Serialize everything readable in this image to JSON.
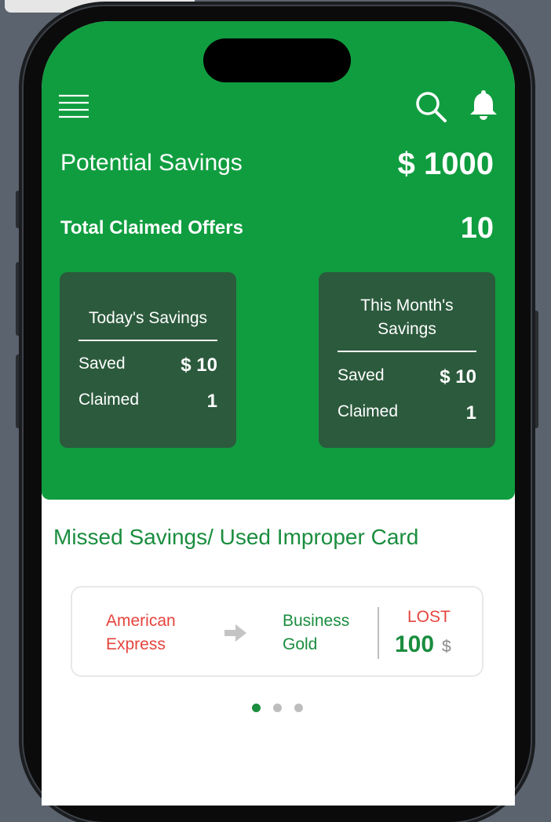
{
  "header": {
    "potential_savings_label": "Potential Savings",
    "potential_savings_value": "$ 1000",
    "total_claimed_label": "Total Claimed Offers",
    "total_claimed_value": "10"
  },
  "cards": {
    "today": {
      "title": "Today's Savings",
      "saved_label": "Saved",
      "saved_value": "$ 10",
      "claimed_label": "Claimed",
      "claimed_value": "1"
    },
    "month": {
      "title": "This Month's Savings",
      "saved_label": "Saved",
      "saved_value": "$ 10",
      "claimed_label": "Claimed",
      "claimed_value": "1"
    }
  },
  "missed": {
    "title": "Missed Savings/ Used Improper Card",
    "used_card_line1": "American",
    "used_card_line2": "Express",
    "better_card_line1": "Business",
    "better_card_line2": "Gold",
    "lost_label": "LOST",
    "lost_amount": "100",
    "currency": "$"
  },
  "icons": {
    "menu": "menu-icon",
    "search": "search-icon",
    "notifications": "bell-icon",
    "arrow": "arrow-right-icon"
  },
  "pager": {
    "pages": 3,
    "active_index": 0
  },
  "colors": {
    "brand_green": "#109d3f",
    "card_dark_green": "#2c5a3d",
    "accent_green_text": "#1a8d3e",
    "alert_red": "#e5443d"
  }
}
